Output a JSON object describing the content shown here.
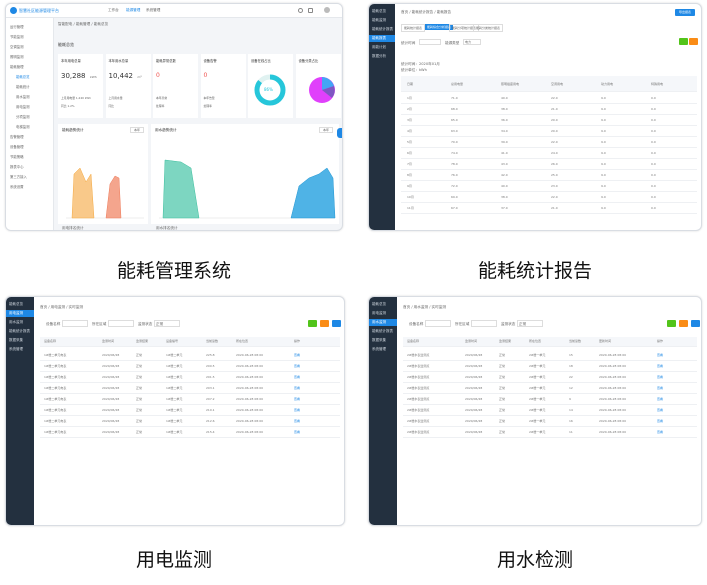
{
  "captions": {
    "s1": "能耗管理系统",
    "s2": "能耗统计报告",
    "s3": "用电监测",
    "s4": "用水检测"
  },
  "s1": {
    "app_title": "智慧社区能源管理平台",
    "nav_tabs": [
      "工作台",
      "能源管理",
      "系统管理"
    ],
    "breadcrumb": "智能配电 / 能耗管理 / 能耗总览",
    "section_title": "能耗总览",
    "sidebar": [
      "运行管理",
      "节能监测",
      "空调监测",
      "照明监测",
      "能耗管理",
      "能耗总览",
      "能耗统计",
      "用水监测",
      "用电监测",
      "分项监测",
      "电梯监测",
      "告警管理",
      "设备管理",
      "节能策略",
      "报表中心",
      "第三方接入",
      "系统设置"
    ],
    "cards": [
      {
        "title": "本年用电总量",
        "value": "30,288",
        "unit": "kWh",
        "sub1": "上月用电量 1,240 kWh",
        "sub2": "同比 1.2%"
      },
      {
        "title": "本年用水总量",
        "value": "10,442",
        "unit": "m³",
        "sub1": "上月用水量",
        "sub2": "同比"
      },
      {
        "title": "能耗异常总数",
        "value": "0",
        "unit": "",
        "sub1": "本年异常",
        "sub2": "处理率"
      },
      {
        "title": "设备告警",
        "value": "0",
        "unit": "",
        "sub1": "本年告警",
        "sub2": "处理率"
      },
      {
        "title": "设备在线占比",
        "value": "86%",
        "unit": "",
        "sub1": "在线",
        "sub2": "离线"
      },
      {
        "title": "设备分类占比",
        "value": "",
        "unit": "",
        "sub1": "",
        "sub2": ""
      }
    ],
    "chart_left": {
      "title": "能耗趋势统计",
      "btn": "本年"
    },
    "chart_right": {
      "title": "用水趋势统计",
      "btn": "本年"
    },
    "bottom_left": "用电排名统计",
    "bottom_right": "用水排名统计"
  },
  "s2": {
    "sidebar": [
      "能耗总览",
      "能耗监测",
      "能耗统计报表",
      "能耗报表",
      "用能计划",
      "数据分析"
    ],
    "breadcrumb": "首页 / 能耗统计报告 / 能耗报告",
    "tabs": [
      "能耗统计报表",
      "能耗综合分析报表",
      "能耗分项统计报表",
      "能耗分类统计报表"
    ],
    "filter_label1": "统计时间",
    "filter_label2": "能源类型",
    "filter_val": "电力",
    "export_btn": "导出报表",
    "info1": "统计时间：2020年01月",
    "info2": "统计单位：kWh",
    "headers": [
      "日期",
      "总用电量",
      "照明插座用电",
      "空调用电",
      "动力用电",
      "特殊用电"
    ],
    "rows": [
      [
        "1月",
        "71.0",
        "40.0",
        "22.0",
        "9.0",
        "0.0"
      ],
      [
        "2月",
        "68.0",
        "38.0",
        "21.0",
        "9.0",
        "0.0"
      ],
      [
        "3月",
        "65.0",
        "36.0",
        "20.0",
        "9.0",
        "0.0"
      ],
      [
        "4月",
        "63.0",
        "34.0",
        "20.0",
        "9.0",
        "0.0"
      ],
      [
        "5月",
        "70.0",
        "39.0",
        "22.0",
        "9.0",
        "0.0"
      ],
      [
        "6月",
        "74.0",
        "41.0",
        "24.0",
        "9.0",
        "0.0"
      ],
      [
        "7月",
        "78.0",
        "43.0",
        "26.0",
        "9.0",
        "0.0"
      ],
      [
        "8月",
        "76.0",
        "42.0",
        "25.0",
        "9.0",
        "0.0"
      ],
      [
        "9月",
        "72.0",
        "40.0",
        "23.0",
        "9.0",
        "0.0"
      ],
      [
        "10月",
        "69.0",
        "38.0",
        "22.0",
        "9.0",
        "0.0"
      ],
      [
        "11月",
        "67.0",
        "37.0",
        "21.0",
        "9.0",
        "0.0"
      ]
    ]
  },
  "s3": {
    "sidebar": [
      "能耗总览",
      "用电监测",
      "用水监测",
      "能耗统计报表",
      "数据采集",
      "系统管理"
    ],
    "breadcrumb": "首页 / 用电监测 / 实时监测",
    "filters": [
      "设备名称",
      "所在区域",
      "监测状态"
    ],
    "filter_val": "正常",
    "headers": [
      "设备名称",
      "监测时间",
      "监测结果",
      "设备编号",
      "当前读数",
      "所在位置",
      "操作"
    ],
    "rows": [
      [
        "1#楼二单元电表",
        "2020/06/28",
        "正常",
        "1#楼二单元",
        "225.8",
        "2020-06-28 08:00",
        "查看"
      ],
      [
        "1#楼二单元电表",
        "2020/06/28",
        "正常",
        "1#楼二单元",
        "200.5",
        "2020-06-28 08:00",
        "查看"
      ],
      [
        "1#楼二单元电表",
        "2020/06/28",
        "正常",
        "1#楼二单元",
        "201.5",
        "2020-06-28 08:00",
        "查看"
      ],
      [
        "1#楼二单元电表",
        "2020/06/28",
        "正常",
        "1#楼二单元",
        "203.1",
        "2020-06-28 08:00",
        "查看"
      ],
      [
        "1#楼二单元电表",
        "2020/06/28",
        "正常",
        "1#楼二单元",
        "207.2",
        "2020-06-28 08:00",
        "查看"
      ],
      [
        "1#楼二单元电表",
        "2020/06/28",
        "正常",
        "1#楼二单元",
        "210.1",
        "2020-06-28 08:00",
        "查看"
      ],
      [
        "1#楼二单元电表",
        "2020/06/28",
        "正常",
        "1#楼二单元",
        "212.6",
        "2020-06-28 08:00",
        "查看"
      ],
      [
        "1#楼二单元电表",
        "2020/06/28",
        "正常",
        "1#楼二单元",
        "215.4",
        "2020-06-28 08:00",
        "查看"
      ]
    ]
  },
  "s4": {
    "sidebar": [
      "能耗总览",
      "用电监测",
      "用水监测",
      "能耗统计报表",
      "数据采集",
      "系统管理"
    ],
    "breadcrumb": "首页 / 用水监测 / 实时监测",
    "filters": [
      "设备名称",
      "所在区域",
      "监测状态"
    ],
    "filter_val": "正常",
    "headers": [
      "设备名称",
      "监测时间",
      "监测结果",
      "所在位置",
      "当前读数",
      "更新时间",
      "操作"
    ],
    "rows": [
      [
        "2#楼水表监测点",
        "2020/06/28",
        "正常",
        "2#楼一单元",
        "15",
        "2020-06-28 08:00",
        "查看"
      ],
      [
        "2#楼水表监测点",
        "2020/06/28",
        "正常",
        "2#楼一单元",
        "18",
        "2020-06-28 08:00",
        "查看"
      ],
      [
        "2#楼水表监测点",
        "2020/06/28",
        "正常",
        "2#楼一单元",
        "22",
        "2020-06-28 08:00",
        "查看"
      ],
      [
        "2#楼水表监测点",
        "2020/06/28",
        "正常",
        "2#楼一单元",
        "12",
        "2020-06-28 08:00",
        "查看"
      ],
      [
        "2#楼水表监测点",
        "2020/06/28",
        "正常",
        "2#楼一单元",
        "9",
        "2020-06-28 08:00",
        "查看"
      ],
      [
        "2#楼水表监测点",
        "2020/06/28",
        "正常",
        "2#楼一单元",
        "14",
        "2020-06-28 08:00",
        "查看"
      ],
      [
        "2#楼水表监测点",
        "2020/06/28",
        "正常",
        "2#楼一单元",
        "16",
        "2020-06-28 08:00",
        "查看"
      ],
      [
        "2#楼水表监测点",
        "2020/06/28",
        "正常",
        "2#楼一单元",
        "11",
        "2020-06-28 08:00",
        "查看"
      ]
    ]
  },
  "colors": {
    "accent": "#1e88e5",
    "green": "#52c41a",
    "orange": "#fa8c16",
    "sidebar": "#23303f"
  }
}
